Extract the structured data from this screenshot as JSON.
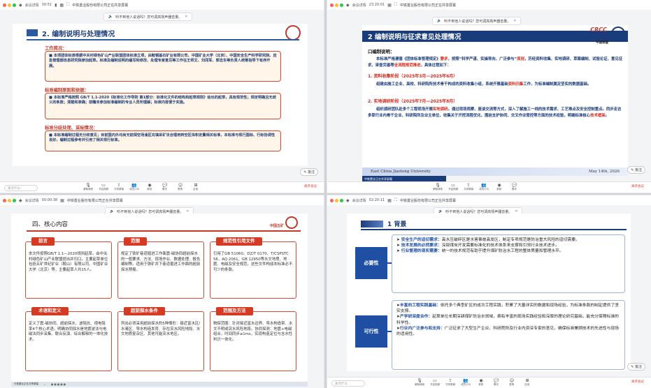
{
  "meeting": {
    "app_name": "会议详情",
    "timer_q1": "30:51",
    "timer_q2": "23:20:01",
    "timer_q3": "00:00:38",
    "timer_q4": "02:20:11",
    "sharing_label": "中铁置业股份有限公司正在共享屏幕",
    "sharing_label_short": "中铁置业正在共享屏幕",
    "audio_notice": "听不到他人说话吗？您可调高扬声器音量。",
    "speak_placeholder": "发点什么",
    "annotate_label": "批注",
    "end_label": "离开会议",
    "toolbar": [
      {
        "icon": "mic-icon",
        "label": "解除静音"
      },
      {
        "icon": "video-icon",
        "label": "开启视频"
      },
      {
        "icon": "share-icon",
        "label": "共享屏幕"
      },
      {
        "icon": "members-icon",
        "label": "成员(25)"
      },
      {
        "icon": "record-icon",
        "label": "录制"
      },
      {
        "icon": "chat-icon",
        "label": "聊天"
      },
      {
        "icon": "reaction-icon",
        "label": "表情"
      },
      {
        "icon": "apps-icon",
        "label": "应用"
      }
    ]
  },
  "slide1": {
    "title": "2. 编制说明与处理情况",
    "sections": [
      {
        "heading": "工作简况：",
        "body": "本项团体标准根据中关村绿色矿山产业联盟团体标准立项，由鞍钢基石矿业有限公司、中国矿业大学（北京）、中国安全生产科学研究院、应急管理部信息研究院参加起草。标准及编制说明的编写和修改、处理专家意见等工作在王师文、刘闯军、郭志东等负责人统筹指导下有序开展。"
      },
      {
        "heading": "标准编制原则和依据：",
        "body": "本标准严格按照 GB/T 1.1-2020《标准化工作导则 第1部分：标准化文件的结构和起草规则》给出的起草，具有规范性；规定明确且无歧义的条款；清楚和准确；前瞻未参加标准编制的专业人员所理解；标准内容便于实施。"
      },
      {
        "heading": "标准分歧处理、采标情况：",
        "body": "本标准编制过程无分歧意见；目前国内外均尚无前探空场涌区充填采矿法合理用转空区体积定量相关标准，本标准与现行国标、行标协调性良好，编制过程参考并引用了相关现行标准。"
      }
    ]
  },
  "slide2": {
    "title": "2 编制说明与征求意见处理情况",
    "logo_text": "CRCC",
    "logo_sub": "中国铁建",
    "heading": "口编制说明：",
    "intro_a": "本标准严格遵循《团体标准管理规定》",
    "intro_red1": "要求",
    "intro_b": "，按照“科学严谨、实操导向、广泛参与”",
    "intro_red2": "原则",
    "intro_c": "，历经资料收集、实地调研、草案编制、试验论证、意见征求、审查完善等",
    "intro_red3": "全流程规范推进",
    "intro_d": "，具体过程如下：",
    "phase1_title": "1. 资料收集阶段（2025年3月—2025年6月）",
    "phase1_a": "组建由施工企业、高校、科研院所技术骨干构成的资料收集小组，系统开展基础",
    "phase1_red": "资料归集",
    "phase1_b": "工作，为标准编制奠定坚实的数据基础。",
    "phase2_title": "2. 实地调研阶段（2025年7月—2025年8月）",
    "phase2_a": "组织调研团队赴多个工程现场开展",
    "phase2_red1": "实地调研",
    "phase2_b": "。通过现场观摩、座谈交流等方式，深入了解施工一线的技术需求、工艺难点及安全控制重点。同步走访多家行业内骨干企业、科研院所及业主单位，收集关于开挖流程优化、围岩支护协同、交叉作业管控等方面的技术经验，明确标准核心",
    "phase2_red2": "技术框架",
    "phase2_c": "。",
    "footer_left": "East China Jiaotong University",
    "footer_right": "May 14th, 2026"
  },
  "slide3": {
    "title": "四、核心内容",
    "logo_text": "中国五矿",
    "cards": [
      {
        "tag": "前言",
        "body": "本文件按照GB/T 1.1—2020规则起草。由中关村绿色矿山产业联盟提出并归口。主要起草单位包括五矿世纪矿业（鞍山）有限公司、中国矿业大学（北京）等，主要起草人共15人。"
      },
      {
        "tag": "范围",
        "body": "规定了铁矿巷道掘进工作面震-磁协同超前探水的一般要求、方法、现场作业、数据处理、报告编制等。适用于铁矿井下巷道掘进工作面的超前探水预报。"
      },
      {
        "tag": "规范性引用文件",
        "body": "引用了GB 51060、DZ/T 0170、T/CSPSTC 56、AQ 2061、GB 12950等水文地质、地震、电磁及安全规范。这些文件构成本标准必不可少的条款。"
      },
      {
        "tag": "术语和定义",
        "body": "定义了震-磁协同、超前探水、波阻抗、视电阻率4个核心术语。明确协同探水是地震波法与电磁法同步采集、联合反演、综合解释的一体化技术。"
      },
      {
        "tag": "超前探水条件",
        "body": "列出必须采用超前探水的5种情形：接近富水区/水淹区、导水构造发育、存在突水风险地段、水文地质复杂区、其他可能突水地区。"
      },
      {
        "tag": "范围及方法",
        "body": "物探范围：针对接近富水边界、导水构造带、水文不明或突水风险地段。协同探测：地震+电磁组合，时间同步≤1ms，实现构造定位与含水性判识一体化。"
      }
    ]
  },
  "slide4": {
    "title": "1 背景",
    "groups": [
      {
        "label": "必要性",
        "items": [
          {
            "head": "安全生产的迫切需求：",
            "body": "高水压破碎区是水害事故高发区，制定专项规范是防治重大风险的迫切需要。"
          },
          {
            "head": "技术发展的必然要求：",
            "body": "深部煤炭开发需要标准化的技术体系来支撑和引领行业技术进步。"
          },
          {
            "head": "行业管理的现实需要：",
            "body": "统一的技术规范有助于提升煤矿防治水工程的整体质量和管理水平。"
          }
        ]
      },
      {
        "label": "可行性",
        "items": [
          {
            "head": "丰富的工程实践基础：",
            "body": "依托多个典型矿区的成功工程实践，积累了大量详实的数据和现场经验，为标准条款的制定提供了坚实支撑。"
          },
          {
            "head": "产学研深度合作：",
            "body": "起草单位长期深耕煤矿防治水领域，拥有丰富的现场实践经验和深厚的理论研究基础，能充分保障标准的科学性。"
          },
          {
            "head": "行业内广泛参与和支持：",
            "body": "广泛征求了大型生产企业、科研院所及行业内资深专家的意见，确保标准兼顾技术的先进性与现场的适用性。"
          }
        ]
      }
    ]
  }
}
